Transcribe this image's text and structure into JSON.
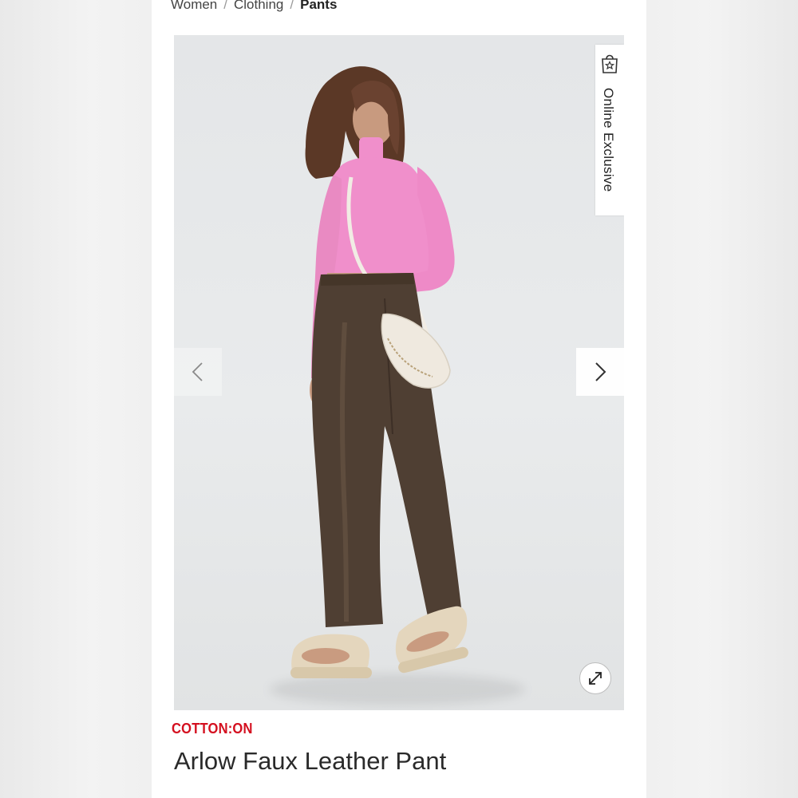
{
  "breadcrumb": {
    "items": [
      "Women",
      "Clothing"
    ],
    "separator": "/",
    "current": "Pants"
  },
  "gallery": {
    "badge_label": "Online Exclusive",
    "badge_icon": "shopping-bag-star-icon",
    "prev_icon": "chevron-left-icon",
    "next_icon": "chevron-right-icon",
    "zoom_icon": "expand-arrows-icon"
  },
  "product": {
    "brand": "COTTON:ON",
    "title": "Arlow Faux Leather Pant"
  },
  "colors": {
    "brand_red": "#d40f1f",
    "top_pink": "#f08fcb",
    "pants_brown": "#4f3f33",
    "bag_cream": "#efe9df",
    "sandal_beige": "#e4d6bd"
  }
}
